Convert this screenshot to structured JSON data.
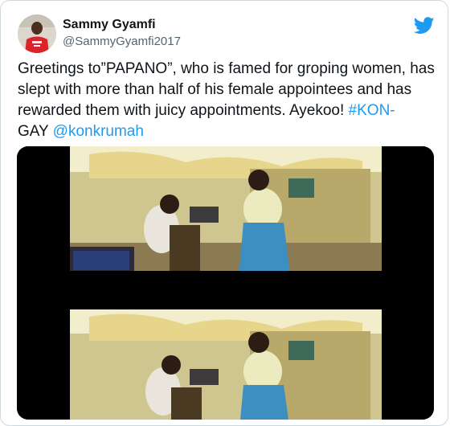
{
  "author": {
    "name": "Sammy Gyamfi",
    "handle": "@SammyGyamfi2017"
  },
  "tweet": {
    "text_before": "Greetings to”PAPANO”, who is famed for groping women, has slept with more than half of his female appointees and has rewarded them with juicy appointments. Ayekoo! ",
    "hashtag": "#KON-",
    "text_mid": "GAY ",
    "mention": "@konkrumah"
  },
  "icons": {
    "brand": "twitter-bird-icon"
  },
  "colors": {
    "link": "#1d9bf0",
    "text": "#0f1419",
    "secondary": "#536471"
  }
}
